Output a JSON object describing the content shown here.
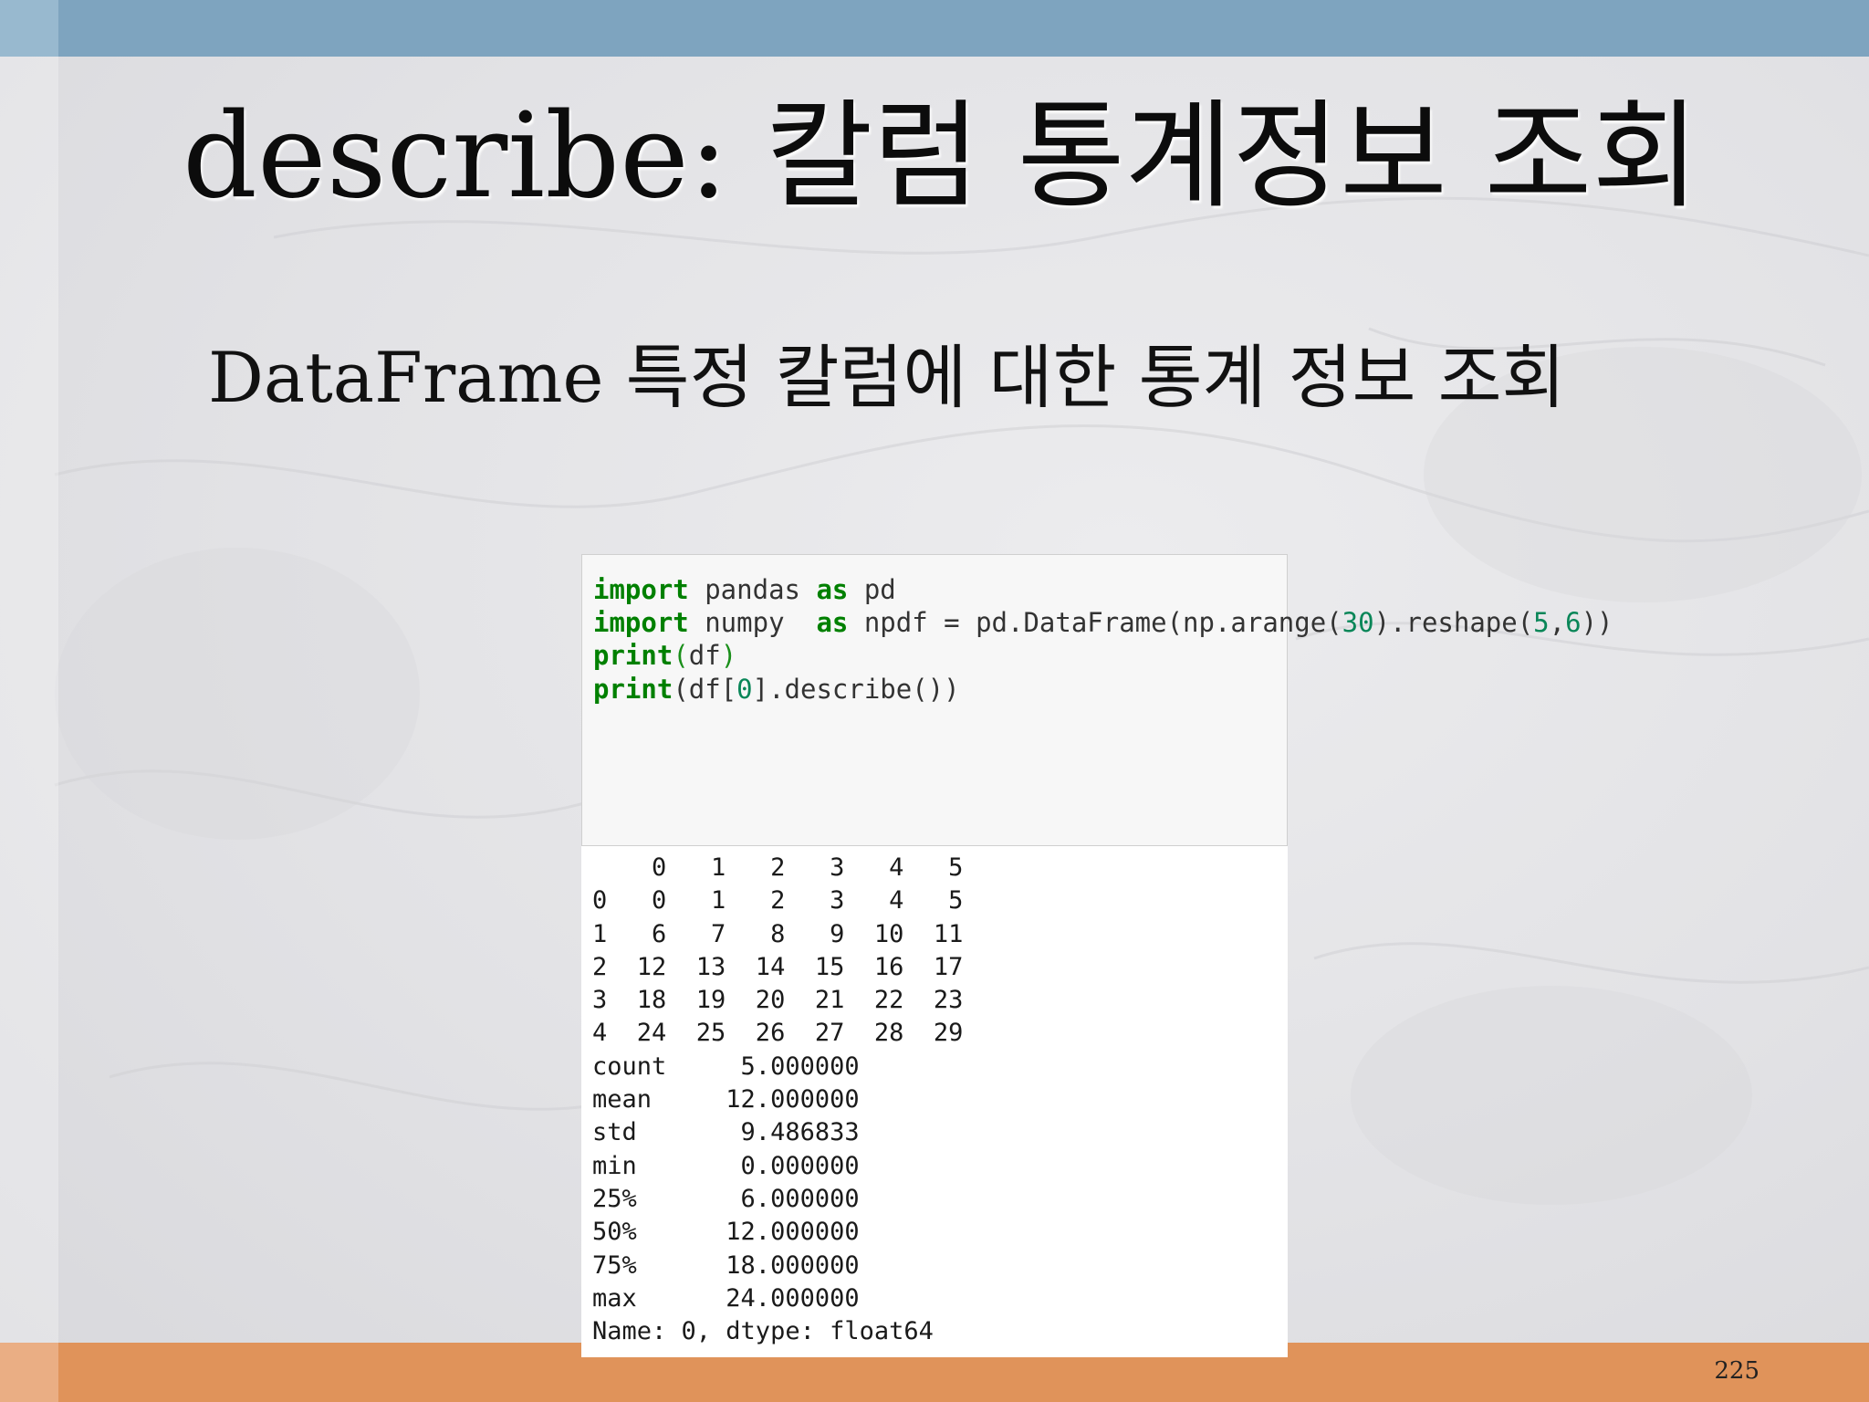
{
  "slide": {
    "title": "describe: 칼럼 통계정보 조회",
    "subtitle": "DataFrame 특정 칼럼에 대한 통계 정보 조회",
    "page_number": "225"
  },
  "code": {
    "line1": {
      "kw1": "import",
      "mid": " pandas ",
      "kw2": "as",
      "end": " pd"
    },
    "line2": {
      "kw1": "import",
      "mid": " numpy  ",
      "kw2": "as",
      "end": " np"
    },
    "line3": {
      "a": "df = pd.DataFrame(np.arange(",
      "n1": "30",
      "b": ").reshape(",
      "n2": "5",
      "c": ",",
      "n3": "6",
      "d": "))"
    },
    "line4": {
      "kw": "print",
      "open": "(",
      "body": "df",
      "close": ")"
    },
    "line5": {
      "kw": "print",
      "a": "(df[",
      "n": "0",
      "b": "].describe())"
    }
  },
  "output": {
    "lines": [
      "    0   1   2   3   4   5",
      "0   0   1   2   3   4   5",
      "1   6   7   8   9  10  11",
      "2  12  13  14  15  16  17",
      "3  18  19  20  21  22  23",
      "4  24  25  26  27  28  29",
      "count     5.000000",
      "mean     12.000000",
      "std       9.486833",
      "min       0.000000",
      "25%       6.000000",
      "50%      12.000000",
      "75%      18.000000",
      "max      24.000000",
      "Name: 0, dtype: float64"
    ]
  },
  "colors": {
    "top_bar": "#7ea4bf",
    "bottom_bar": "#e0935a",
    "keyword": "#008000",
    "number": "#098658"
  }
}
